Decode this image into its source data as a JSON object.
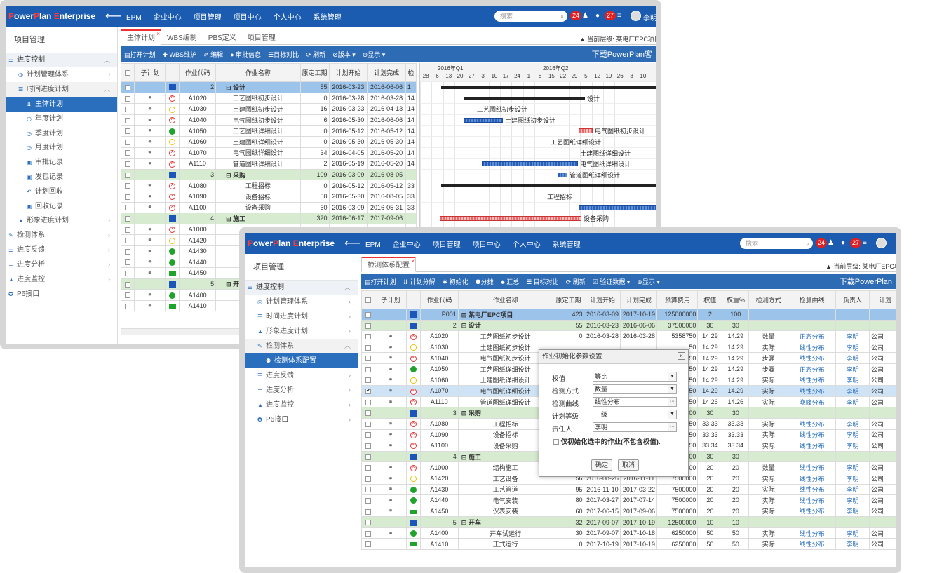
{
  "app": {
    "logo_prefix": "P",
    "logo_a": "ower",
    "logo_p": "P",
    "logo_b": "lan ",
    "logo_e": "E",
    "logo_c": "nterprise",
    "back": "⟵",
    "nav": [
      "EPM",
      "企业中心",
      "项目管理",
      "项目中心",
      "个人中心",
      "系统管理"
    ],
    "search_placeholder": "搜索",
    "notif_count": "24",
    "msg_count": "27",
    "user": "李明"
  },
  "sidebar": {
    "title": "项目管理",
    "section": "进度控制",
    "items": [
      {
        "label": "计划管理体系",
        "icon": "◎"
      },
      {
        "label": "时间进度计划",
        "icon": "☰"
      },
      {
        "label": "主体计划",
        "icon": "⇊"
      },
      {
        "label": "年度计划",
        "icon": "◷"
      },
      {
        "label": "季度计划",
        "icon": "◷"
      },
      {
        "label": "月度计划",
        "icon": "◷"
      },
      {
        "label": "审批记录",
        "icon": "▣"
      },
      {
        "label": "发包记录",
        "icon": "▣"
      },
      {
        "label": "计划回收",
        "icon": "↶"
      },
      {
        "label": "回收记录",
        "icon": "▣"
      },
      {
        "label": "形象进度计划",
        "icon": "▲"
      },
      {
        "label": "检测体系",
        "icon": "✎"
      },
      {
        "label": "进度反馈",
        "icon": "☰"
      },
      {
        "label": "进度分析",
        "icon": "≑"
      },
      {
        "label": "进度监控",
        "icon": "▲"
      },
      {
        "label": "P6接口",
        "icon": "✪"
      }
    ]
  },
  "sidebar2": {
    "items": [
      {
        "label": "计划管理体系",
        "icon": "◎"
      },
      {
        "label": "时间进度计划",
        "icon": "☰"
      },
      {
        "label": "形象进度计划",
        "icon": "▲"
      },
      {
        "label": "检测体系",
        "icon": "✎"
      },
      {
        "label": "检测体系配置",
        "icon": "⚉"
      },
      {
        "label": "进度反馈",
        "icon": "☰"
      },
      {
        "label": "进度分析",
        "icon": "≑"
      },
      {
        "label": "进度监控",
        "icon": "▲"
      },
      {
        "label": "P6接口",
        "icon": "✪"
      }
    ]
  },
  "w1": {
    "tabs": [
      "主体计划",
      "WBS编制",
      "PBS定义",
      "项目管理"
    ],
    "crumb": "▲ 当前层级: 某电厂EPC项目",
    "toolbar": [
      "▤打开计划",
      "✚ WBS维护",
      "✐ 编辑",
      "● 审批信息",
      "☰目标对比",
      "⟳ 刷新",
      "⊘版本 ▾",
      "⊕显示 ▾"
    ],
    "toolbar_right": "下载PowerPlan客",
    "cols": [
      "子计划",
      "作业代码",
      "作业名称",
      "原定工期",
      "计划开始",
      "计划完成",
      "检"
    ],
    "rows": [
      {
        "t": "wbs1",
        "code": "2",
        "name": "⊟ 设计",
        "dur": "55",
        "s": "2016-03-23",
        "f": "2016-06-06",
        "x": "1"
      },
      {
        "t": "a",
        "st": "red",
        "code": "A1020",
        "name": "工艺图纸初步设计",
        "dur": "0",
        "s": "2016-03-28",
        "f": "2016-03-28",
        "x": "14"
      },
      {
        "t": "a",
        "st": "yel",
        "code": "A1030",
        "name": "土建图纸初步设计",
        "dur": "16",
        "s": "2016-03-23",
        "f": "2016-04-13",
        "x": "14"
      },
      {
        "t": "a",
        "st": "red",
        "code": "A1040",
        "name": "电气图纸初步设计",
        "dur": "6",
        "s": "2016-05-30",
        "f": "2016-06-06",
        "x": "14"
      },
      {
        "t": "a",
        "st": "grn",
        "code": "A1050",
        "name": "工艺图纸详细设计",
        "dur": "0",
        "s": "2016-05-12",
        "f": "2016-05-12",
        "x": "14"
      },
      {
        "t": "a",
        "st": "yel",
        "code": "A1060",
        "name": "土建图纸详细设计",
        "dur": "0",
        "s": "2016-05-30",
        "f": "2016-05-30",
        "x": "14"
      },
      {
        "t": "a",
        "st": "red",
        "code": "A1070",
        "name": "电气图纸详细设计",
        "dur": "34",
        "s": "2016-04-05",
        "f": "2016-05-20",
        "x": "14"
      },
      {
        "t": "a",
        "st": "red",
        "code": "A1110",
        "name": "管道图纸详细设计",
        "dur": "2",
        "s": "2016-05-19",
        "f": "2016-05-20",
        "x": "14"
      },
      {
        "t": "wbs2",
        "code": "3",
        "name": "⊟ 采购",
        "dur": "109",
        "s": "2016-03-09",
        "f": "2016-08-05",
        "x": ""
      },
      {
        "t": "a",
        "st": "red",
        "code": "A1080",
        "name": "工程招标",
        "dur": "0",
        "s": "2016-05-12",
        "f": "2016-05-12",
        "x": "33"
      },
      {
        "t": "a",
        "st": "red",
        "code": "A1090",
        "name": "设备招标",
        "dur": "50",
        "s": "2016-05-30",
        "f": "2016-08-05",
        "x": "33"
      },
      {
        "t": "a",
        "st": "red",
        "code": "A1100",
        "name": "设备采购",
        "dur": "60",
        "s": "2016-03-09",
        "f": "2016-05-31",
        "x": "33"
      },
      {
        "t": "wbs2",
        "code": "4",
        "name": "⊟ 施工",
        "dur": "320",
        "s": "2016-06-17",
        "f": "2017-09-06",
        "x": ""
      },
      {
        "t": "a",
        "st": "red",
        "code": "A1000",
        "name": "结",
        "dur": "",
        "s": "",
        "f": "",
        "x": ""
      },
      {
        "t": "a",
        "st": "yel",
        "code": "A1420",
        "name": "工",
        "dur": "",
        "s": "",
        "f": "",
        "x": ""
      },
      {
        "t": "a",
        "st": "grn",
        "code": "A1430",
        "name": "工",
        "dur": "",
        "s": "",
        "f": "",
        "x": ""
      },
      {
        "t": "a",
        "st": "grn",
        "code": "A1440",
        "name": "电",
        "dur": "",
        "s": "",
        "f": "",
        "x": ""
      },
      {
        "t": "a",
        "st": "rect",
        "code": "A1450",
        "name": "仪",
        "dur": "",
        "s": "",
        "f": "",
        "x": ""
      },
      {
        "t": "wbs2",
        "code": "5",
        "name": "⊟ 开车",
        "dur": "",
        "s": "",
        "f": "",
        "x": ""
      },
      {
        "t": "a",
        "st": "grn",
        "code": "A1400",
        "name": "开",
        "dur": "",
        "s": "",
        "f": "",
        "x": ""
      },
      {
        "t": "a",
        "st": "rect",
        "code": "A1410",
        "name": "正",
        "dur": "",
        "s": "",
        "f": "",
        "x": ""
      }
    ],
    "gantt": {
      "q1": "2016年Q1",
      "q2": "2016年Q2",
      "days": [
        "28",
        "6",
        "13",
        "20",
        "27",
        "3",
        "10",
        "17",
        "24",
        "1",
        "8",
        "15",
        "22",
        "29",
        "5",
        "12",
        "19",
        "26",
        "3",
        "10"
      ],
      "labels": [
        "设计",
        "工艺图纸初步设计",
        "土建图纸初步设计",
        "电气图纸初步设计",
        "工艺图纸详细设计",
        "土建图纸详细设计",
        "电气图纸详细设计",
        "管道图纸详细设计",
        "工程招标",
        "设备采购"
      ]
    }
  },
  "w2": {
    "tab": "检测体系配置",
    "crumb": "▲ 当前层级: 某电厂EPC项",
    "toolbar": [
      "▤打开计划",
      "⇊ 计划分解",
      "✱ 初始化",
      "❶分摊",
      "♣ 汇总",
      "☰ 目标对比",
      "⟳ 刷新",
      "☑ 验证数据 ▾",
      "⊕显示 ▾"
    ],
    "toolbar_right": "下载PowerPlan",
    "cols": [
      "子计划",
      "作业代码",
      "作业名称",
      "原定工期",
      "计划开始",
      "计划完成",
      "预算费用",
      "权值",
      "权重%",
      "检测方式",
      "检测曲线",
      "负责人",
      "计划"
    ],
    "rows": [
      {
        "t": "wbs1",
        "code": "P001",
        "name": "⊟ 某电厂EPC项目",
        "dur": "423",
        "s": "2016-03-09",
        "f": "2017-10-19",
        "b": "125000000",
        "w": "2",
        "p": "100",
        "m": "",
        "c": "",
        "r": "",
        "k": ""
      },
      {
        "t": "wbs2",
        "code": "2",
        "name": "⊟ 设计",
        "dur": "55",
        "s": "2016-03-23",
        "f": "2016-06-06",
        "b": "37500000",
        "w": "30",
        "p": "30",
        "m": "",
        "c": "",
        "r": "",
        "k": ""
      },
      {
        "t": "a",
        "st": "red",
        "lk": "⚭",
        "code": "A1020",
        "name": "工艺图纸初步设计",
        "dur": "0",
        "s": "2016-03-28",
        "f": "2016-03-28",
        "b": "5358750",
        "w": "14.29",
        "p": "14.29",
        "m": "数量",
        "c": "正态分布",
        "r": "李明",
        "k": "公司"
      },
      {
        "t": "a",
        "st": "yel",
        "lk": "⚭",
        "code": "A1030",
        "name": "土建图纸初步设计",
        "dur": "",
        "s": "",
        "f": "",
        "b": "50",
        "w": "14.29",
        "p": "14.29",
        "m": "实际",
        "c": "线性分布",
        "r": "李明",
        "k": "公司"
      },
      {
        "t": "a",
        "st": "red",
        "lk": "⚭",
        "code": "A1040",
        "name": "电气图纸初步设计",
        "dur": "",
        "s": "",
        "f": "",
        "b": "50",
        "w": "14.29",
        "p": "14.29",
        "m": "步骤",
        "c": "线性分布",
        "r": "李明",
        "k": "公司"
      },
      {
        "t": "a",
        "st": "grn",
        "lk": "⚭",
        "code": "A1050",
        "name": "工艺图纸详细设计",
        "dur": "",
        "s": "",
        "f": "",
        "b": "50",
        "w": "14.29",
        "p": "14.29",
        "m": "步骤",
        "c": "正态分布",
        "r": "李明",
        "k": "公司"
      },
      {
        "t": "a",
        "st": "yel",
        "lk": "⚭",
        "code": "A1060",
        "name": "土建图纸详细设计",
        "dur": "",
        "s": "",
        "f": "",
        "b": "50",
        "w": "14.29",
        "p": "14.29",
        "m": "实际",
        "c": "线性分布",
        "r": "李明",
        "k": "公司"
      },
      {
        "t": "sel",
        "st": "red",
        "lk": "⚭",
        "code": "A1070",
        "name": "电气图纸详细设计",
        "dur": "",
        "s": "",
        "f": "",
        "b": "50",
        "w": "14.29",
        "p": "14.29",
        "m": "实际",
        "c": "线性分布",
        "r": "李明",
        "k": "公司"
      },
      {
        "t": "a",
        "st": "red",
        "lk": "⚭",
        "code": "A1110",
        "name": "管道图纸详细设计",
        "dur": "",
        "s": "",
        "f": "",
        "b": "50",
        "w": "14.26",
        "p": "14.26",
        "m": "实际",
        "c": "晚峰分布",
        "r": "李明",
        "k": "公司"
      },
      {
        "t": "wbs2",
        "code": "3",
        "name": "⊟ 采购",
        "dur": "",
        "s": "",
        "f": "",
        "b": "00",
        "w": "30",
        "p": "30",
        "m": "",
        "c": "",
        "r": "",
        "k": ""
      },
      {
        "t": "a",
        "st": "red",
        "lk": "⚭",
        "code": "A1080",
        "name": "工程招标",
        "dur": "",
        "s": "",
        "f": "",
        "b": "50",
        "w": "33.33",
        "p": "33.33",
        "m": "实际",
        "c": "线性分布",
        "r": "李明",
        "k": "公司"
      },
      {
        "t": "a",
        "st": "red",
        "lk": "⚭",
        "code": "A1090",
        "name": "设备招标",
        "dur": "",
        "s": "",
        "f": "",
        "b": "50",
        "w": "33.33",
        "p": "33.33",
        "m": "实际",
        "c": "线性分布",
        "r": "李明",
        "k": "公司"
      },
      {
        "t": "a",
        "st": "red",
        "lk": "⚭",
        "code": "A1100",
        "name": "设备采购",
        "dur": "",
        "s": "",
        "f": "",
        "b": "50",
        "w": "33.34",
        "p": "33.34",
        "m": "实际",
        "c": "线性分布",
        "r": "李明",
        "k": "公司"
      },
      {
        "t": "wbs2",
        "code": "4",
        "name": "⊟ 施工",
        "dur": "",
        "s": "",
        "f": "",
        "b": "00",
        "w": "30",
        "p": "30",
        "m": "",
        "c": "",
        "r": "",
        "k": ""
      },
      {
        "t": "a",
        "st": "red",
        "lk": "⚭",
        "code": "A1000",
        "name": "结构施工",
        "dur": "47",
        "s": "2016-06-17",
        "f": "2016-08-22",
        "b": "7500000",
        "w": "20",
        "p": "20",
        "m": "数量",
        "c": "线性分布",
        "r": "李明",
        "k": "公司"
      },
      {
        "t": "a",
        "st": "yel",
        "lk": "⚭",
        "code": "A1420",
        "name": "工艺设备",
        "dur": "56",
        "s": "2016-08-26",
        "f": "2016-11-11",
        "b": "7500000",
        "w": "20",
        "p": "20",
        "m": "实际",
        "c": "线性分布",
        "r": "李明",
        "k": "公司"
      },
      {
        "t": "a",
        "st": "grn",
        "lk": "⚭",
        "code": "A1430",
        "name": "工艺管道",
        "dur": "95",
        "s": "2016-11-10",
        "f": "2017-03-22",
        "b": "7500000",
        "w": "20",
        "p": "20",
        "m": "实际",
        "c": "线性分布",
        "r": "李明",
        "k": "公司"
      },
      {
        "t": "a",
        "st": "grn",
        "lk": "⚭",
        "code": "A1440",
        "name": "电气安装",
        "dur": "80",
        "s": "2017-03-27",
        "f": "2017-07-14",
        "b": "7500000",
        "w": "20",
        "p": "20",
        "m": "实际",
        "c": "线性分布",
        "r": "李明",
        "k": "公司"
      },
      {
        "t": "a",
        "st": "rect",
        "lk": "⚭",
        "code": "A1450",
        "name": "仪表安装",
        "dur": "60",
        "s": "2017-06-15",
        "f": "2017-09-06",
        "b": "7500000",
        "w": "20",
        "p": "20",
        "m": "实际",
        "c": "线性分布",
        "r": "李明",
        "k": "公司"
      },
      {
        "t": "wbs2",
        "code": "5",
        "name": "⊟ 开车",
        "dur": "32",
        "s": "2017-09-07",
        "f": "2017-10-19",
        "b": "12500000",
        "w": "10",
        "p": "10",
        "m": "",
        "c": "",
        "r": "",
        "k": ""
      },
      {
        "t": "a",
        "st": "grn",
        "lk": "⚭",
        "code": "A1400",
        "name": "开车试运行",
        "dur": "30",
        "s": "2017-09-07",
        "f": "2017-10-18",
        "b": "6250000",
        "w": "50",
        "p": "50",
        "m": "实际",
        "c": "线性分布",
        "r": "李明",
        "k": "公司"
      },
      {
        "t": "a",
        "st": "rect",
        "lk": "",
        "code": "A1410",
        "name": "正式运行",
        "dur": "0",
        "s": "2017-10-19",
        "f": "2017-10-19",
        "b": "6250000",
        "w": "50",
        "p": "50",
        "m": "实际",
        "c": "线性分布",
        "r": "李明",
        "k": "公司"
      }
    ]
  },
  "dialog": {
    "title": "作业初始化参数设置",
    "close": "×",
    "fields": [
      {
        "label": "权值",
        "value": "等比",
        "kind": "select"
      },
      {
        "label": "检测方式",
        "value": "数量",
        "kind": "select"
      },
      {
        "label": "检测曲线",
        "value": "线性分布",
        "kind": "browse"
      },
      {
        "label": "计划等级",
        "value": "一级",
        "kind": "select"
      },
      {
        "label": "责任人",
        "value": "李明",
        "kind": "browse"
      }
    ],
    "checkbox": "仅初始化选中的作业(不包含权值).",
    "ok": "确定",
    "cancel": "取消"
  }
}
